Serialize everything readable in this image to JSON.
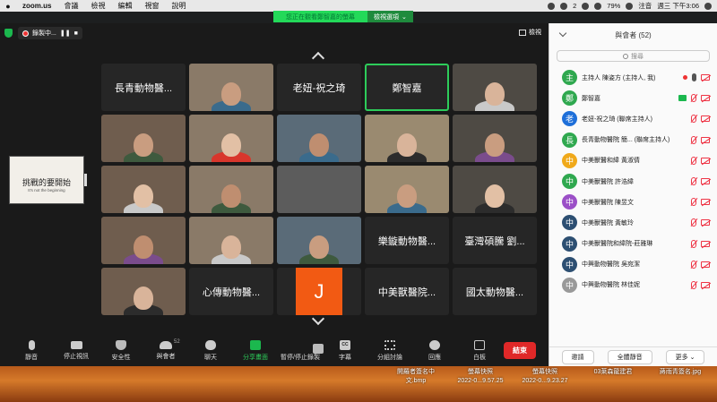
{
  "menubar": {
    "app_name": "zoom.us",
    "menus": [
      "會議",
      "檢視",
      "編輯",
      "視窗",
      "說明"
    ],
    "battery": "79%",
    "input": "注音",
    "datetime": "週三 下午3:06",
    "badge_count": "2"
  },
  "share_banner": {
    "message": "您正在觀看鄭智嘉的螢幕",
    "options_label": "檢視選項"
  },
  "meeting": {
    "recording_label": "錄製中...",
    "view_label": "檢視",
    "self_view_text": "挑戰的要開始",
    "self_view_sub": "It's not the beginning"
  },
  "tiles": [
    {
      "name": "長青動物醫...",
      "type": "name"
    },
    {
      "name": "",
      "type": "video"
    },
    {
      "name": "老妞-祝之琦",
      "type": "name"
    },
    {
      "name": "鄭智嘉",
      "type": "name",
      "active": true
    },
    {
      "name": "",
      "type": "video"
    },
    {
      "name": "",
      "type": "video"
    },
    {
      "name": "",
      "type": "video"
    },
    {
      "name": "",
      "type": "video"
    },
    {
      "name": "",
      "type": "video"
    },
    {
      "name": "",
      "type": "video"
    },
    {
      "name": "",
      "type": "video"
    },
    {
      "name": "",
      "type": "video"
    },
    {
      "name": "",
      "type": "blur"
    },
    {
      "name": "",
      "type": "video"
    },
    {
      "name": "",
      "type": "video"
    },
    {
      "name": "",
      "type": "video"
    },
    {
      "name": "",
      "type": "video"
    },
    {
      "name": "",
      "type": "video"
    },
    {
      "name": "樂鏇動物醫...",
      "type": "name"
    },
    {
      "name": "臺灣碩騰 劉...",
      "type": "name"
    },
    {
      "name": "",
      "type": "video"
    },
    {
      "name": "心傳動物醫...",
      "type": "name"
    },
    {
      "name": "J",
      "type": "avatar"
    },
    {
      "name": "中美獸醫院...",
      "type": "name"
    },
    {
      "name": "國太動物醫...",
      "type": "name"
    }
  ],
  "toolbar": {
    "mute": "靜音",
    "stop_video": "停止視訊",
    "security": "安全性",
    "participants": "與會者",
    "participants_count": "52",
    "chat": "聊天",
    "share_screen": "分享畫面",
    "pause_share": "暫停/停止錄製",
    "captions": "字幕",
    "cc_text": "CC",
    "breakout": "分組討論",
    "reactions": "回應",
    "whiteboard": "白板",
    "end": "結束"
  },
  "panel": {
    "title": "與會者 (52)",
    "search_placeholder": "搜尋",
    "participants": [
      {
        "avatar": "主",
        "name": "主持人 陳姿方 (主持人, 我)",
        "color": "#2fa84f",
        "mic": "on",
        "cam": "off",
        "rec": true
      },
      {
        "avatar": "鄭",
        "name": "鄭智嘉",
        "color": "#2fa84f",
        "mic": "off",
        "cam": "off",
        "share": true
      },
      {
        "avatar": "老",
        "name": "老妞-祝之琦 (聯席主持人)",
        "color": "#1e6fd9",
        "mic": "off",
        "cam": "off"
      },
      {
        "avatar": "長",
        "name": "長青動物醫院 簡... (聯席主持人)",
        "color": "#2fa84f",
        "mic": "off",
        "cam": "off"
      },
      {
        "avatar": "中",
        "name": "中美獸醫和緯 黃淑倩",
        "color": "#f0a91a",
        "mic": "off",
        "cam": "off"
      },
      {
        "avatar": "中",
        "name": "中美獸醫院 許浩緯",
        "color": "#2fa84f",
        "mic": "off",
        "cam": "off"
      },
      {
        "avatar": "中",
        "name": "中美獸醫院 陳昱文",
        "color": "#9b4fc7",
        "mic": "off",
        "cam": "off"
      },
      {
        "avatar": "中",
        "name": "中美獸醫院 黃敏玲",
        "color": "#2d4f72",
        "mic": "off",
        "cam": "off"
      },
      {
        "avatar": "中",
        "name": "中美獸醫院和緯院-莊雅琳",
        "color": "#2d4f72",
        "mic": "off",
        "cam": "off"
      },
      {
        "avatar": "中",
        "name": "中興動物醫院 吳宛潔",
        "color": "#2d4f72",
        "mic": "off",
        "cam": "off"
      },
      {
        "avatar": "中",
        "name": "中興動物醫院 林佳妮",
        "color": "#999999",
        "mic": "off",
        "cam": "off"
      }
    ],
    "invite": "邀請",
    "mute_all": "全體靜音",
    "more": "更多"
  },
  "desktop_files": [
    {
      "line1": "開羅者簽名中",
      "line2": "文.bmp"
    },
    {
      "line1": "螢幕快照",
      "line2": "2022-0...9.57.25"
    },
    {
      "line1": "螢幕快照",
      "line2": "2022-0...9.23.27"
    },
    {
      "line1": "03萊森龍建君",
      "line2": ""
    },
    {
      "line1": "蔣雨青簽名.jpg",
      "line2": ""
    }
  ]
}
